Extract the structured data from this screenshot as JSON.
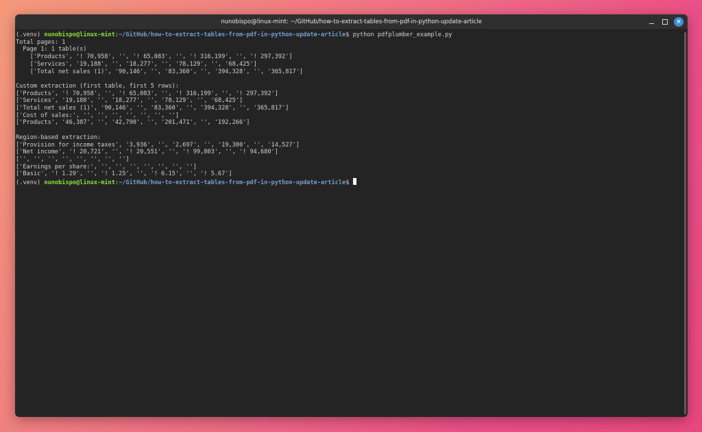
{
  "window": {
    "title": "nunobispo@linux-mint: ~/GitHub/how-to-extract-tables-from-pdf-in-python-update-article",
    "controls": {
      "minimize": "minimize",
      "maximize": "maximize",
      "close": "×"
    }
  },
  "prompt": {
    "venv": "(.venv) ",
    "user_host": "nunobispo@linux-mint",
    "sep": ":",
    "path": "~/GitHub/how-to-extract-tables-from-pdf-in-python-update-article",
    "dollar": "$ ",
    "command": "python pdfplumber_example.py"
  },
  "output": [
    "Total pages: 1",
    "  Page 1: 1 table(s)",
    "    ['Products', '! 70,958', '', '! 65,083', '', '! 316,199', '', '! 297,392']",
    "    ['Services', '19,188', '', '18,277', '', '78,129', '', '68,425']",
    "    ['Total net sales (1)', '90,146', '', '83,360', '', '394,328', '', '365,817']",
    "",
    "Custom extraction (first table, first 5 rows):",
    "['Products', '! 70,958', '', '! 65,083', '', '! 316,199', '', '! 297,392']",
    "['Services', '19,188', '', '18,277', '', '78,129', '', '68,425']",
    "['Total net sales (1)', '90,146', '', '83,360', '', '394,328', '', '365,817']",
    "['Cost of sales:', '', '', '', '', '', '', '']",
    "['Products', '46,387', '', '42,790', '', '201,471', '', '192,266']",
    "",
    "Region-based extraction:",
    "['Provision for income taxes', '3,936', '', '2,697', '', '19,300', '', '14,527']",
    "['Net income', '! 20,721', '', '! 20,551', '', '! 99,803', '', '! 94,680']",
    "['', '', '', '', '', '', '', '']",
    "['Earnings per share:', '', '', '', '', '', '', '']",
    "['Basic', '! 1.29', '', '! 1.25', '', '! 6.15', '', '! 5.67']"
  ],
  "colors": {
    "background": "#242424",
    "user_host": "#8ae234",
    "path": "#729fcf",
    "text": "#d0d0d0",
    "close_button": "#3a8fd9"
  }
}
